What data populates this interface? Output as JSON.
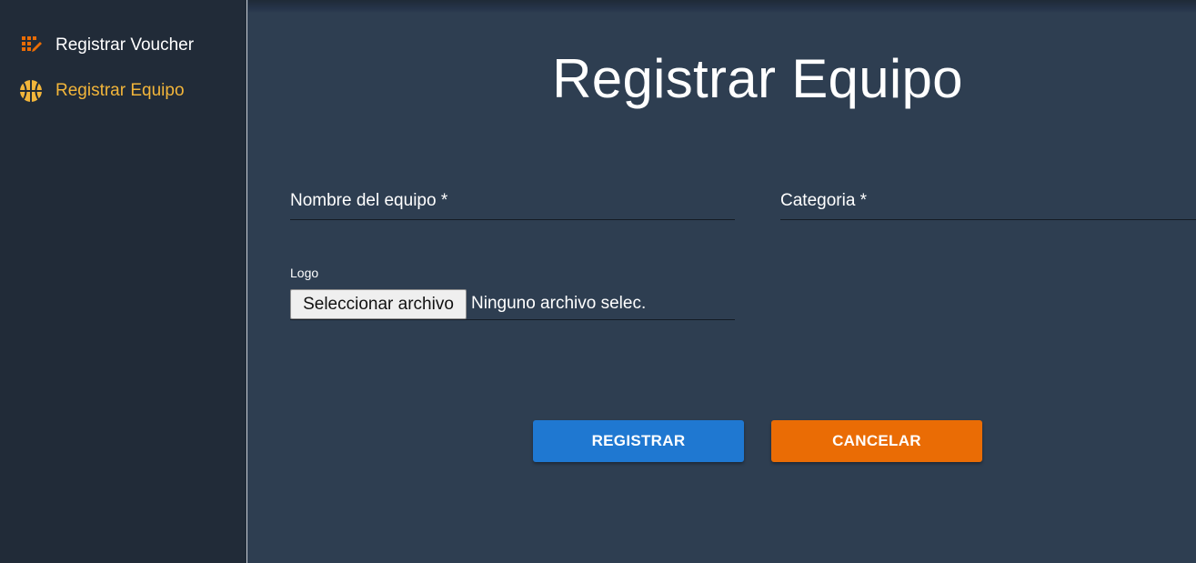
{
  "sidebar": {
    "items": [
      {
        "label": "Registrar Voucher",
        "icon": "voucher-grid-icon",
        "active": false
      },
      {
        "label": "Registrar Equipo",
        "icon": "basketball-icon",
        "active": true
      }
    ]
  },
  "main": {
    "title": "Registrar Equipo",
    "form": {
      "nombre_label": "Nombre del equipo *",
      "categoria_label": "Categoria *",
      "logo_label": "Logo",
      "file_button_label": "Seleccionar archivo",
      "file_status": "Ninguno archivo selec."
    },
    "actions": {
      "registrar_label": "REGISTRAR",
      "cancelar_label": "CANCELAR"
    }
  },
  "colors": {
    "sidebar_bg": "#212b38",
    "main_bg": "#2e3e51",
    "accent_orange": "#ea6c05",
    "accent_yellow": "#f2b53a",
    "primary_blue": "#1f78d1"
  }
}
